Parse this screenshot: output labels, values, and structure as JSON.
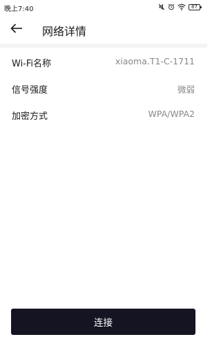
{
  "status_bar": {
    "time": "晚上7:40",
    "battery_level": "87",
    "icons": [
      "mute-icon",
      "alarm-icon",
      "wifi-icon",
      "battery-icon"
    ]
  },
  "header": {
    "title": "网络详情",
    "back_icon": "arrow-left-icon"
  },
  "details": [
    {
      "label": "Wi-Fi名称",
      "value": "xiaoma.T1-C-1711"
    },
    {
      "label": "信号强度",
      "value": "微弱"
    },
    {
      "label": "加密方式",
      "value": "WPA/WPA2"
    }
  ],
  "connect_button": {
    "label": "连接",
    "color": "#141423"
  },
  "colors": {
    "value_text": "#888888",
    "divider": "#f4f4f6"
  }
}
